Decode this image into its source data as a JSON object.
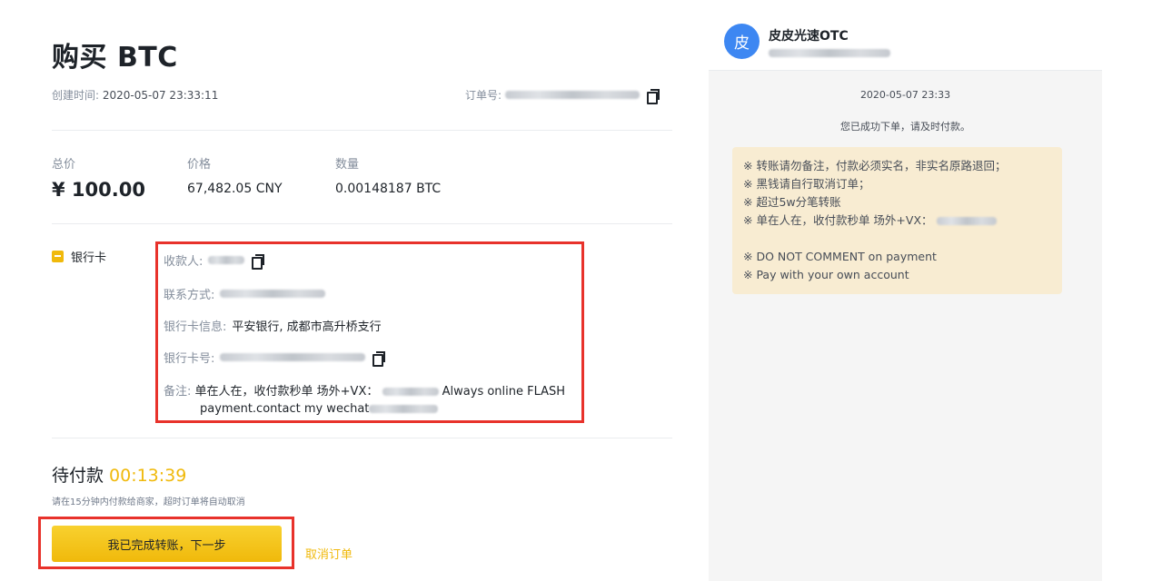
{
  "title": "购买 BTC",
  "created": {
    "label": "创建时间:",
    "value": "2020-05-07 23:33:11"
  },
  "order": {
    "label": "订单号:"
  },
  "summary": {
    "total_label": "总价",
    "total_value": "¥ 100.00",
    "price_label": "价格",
    "price_value": "67,482.05 CNY",
    "qty_label": "数量",
    "qty_value": "0.00148187 BTC"
  },
  "payment": {
    "method": "银行卡",
    "payee_label": "收款人:",
    "contact_label": "联系方式:",
    "bank_info_label": "银行卡信息:",
    "bank_info_value": "平安银行, 成都市高升桥支行",
    "card_label": "银行卡号:",
    "note_label": "备注:",
    "note_value_1": "单在人在，收付款秒单 场外+VX：",
    "note_value_2": "Always online FLASH",
    "note_value_3": "payment.contact my wechat"
  },
  "status": {
    "label": "待付款",
    "timer": "00:13:39",
    "hint": "请在15分钟内付款给商家，超时订单将自动取消"
  },
  "actions": {
    "confirm": "我已完成转账，下一步",
    "cancel": "取消订单"
  },
  "chat": {
    "avatar": "皮",
    "merchant": "皮皮光速OTC",
    "time": "2020-05-07 23:33",
    "system": "您已成功下单，请及时付款。",
    "lines": [
      "※ 转账请勿备注，付款必须实名，非实名原路退回；",
      "※ 黑钱请自行取消订单；",
      "※ 超过5w分笔转账",
      "※ 单在人在，收付款秒单 场外+VX："
    ],
    "lines_en": [
      "※ DO NOT COMMENT on payment",
      "※ Pay with your own account"
    ]
  },
  "colors": {
    "accent": "#f0b90b",
    "highlight": "#e8322b",
    "avatar": "#3d87f2"
  }
}
